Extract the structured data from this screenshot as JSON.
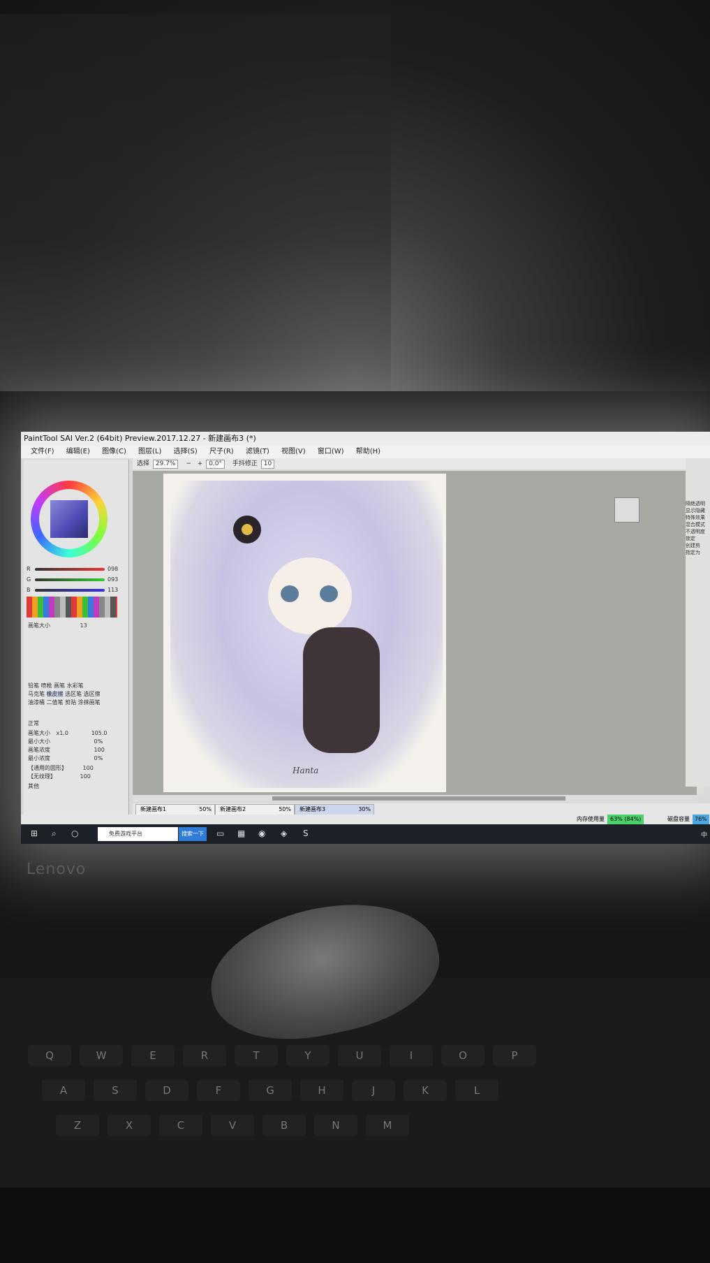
{
  "window": {
    "title": "PaintTool SAI Ver.2 (64bit) Preview.2017.12.27 - 新建画布3 (*)"
  },
  "menu": [
    "文件(F)",
    "编辑(E)",
    "图像(C)",
    "图层(L)",
    "选择(S)",
    "尺子(R)",
    "滤镜(T)",
    "视图(V)",
    "窗口(W)",
    "帮助(H)"
  ],
  "toolbar": {
    "select_label": "选择",
    "zoom": "29.7%",
    "rotation": "0.0°",
    "stabilizer_label": "手抖修正",
    "stabilizer_value": "10"
  },
  "color": {
    "r_label": "R",
    "r": "098",
    "g_label": "G",
    "g": "093",
    "b_label": "B",
    "b": "113"
  },
  "brush": {
    "size_label": "画笔大小",
    "size_value": "13",
    "tools": [
      "铅笔",
      "喷枪",
      "画笔",
      "水彩笔",
      "马克笔",
      "橡皮擦",
      "选区笔",
      "选区擦",
      "油漆桶",
      "二值笔",
      "剪贴",
      "涂抹画笔"
    ],
    "mode": "正常",
    "brush_size_label": "画笔大小",
    "brush_size_mult": "x1.0",
    "brush_size_value": "105.0",
    "min_size_label": "最小大小",
    "min_size_value": "0%",
    "density_label": "画笔浓度",
    "density_value": "100",
    "min_density_label": "最小浓度",
    "min_density_value": "0%",
    "shape_label": "【通用的圆形】",
    "shape_value": "100",
    "texture_label": "【无纹理】",
    "texture_value": "100",
    "other_label": "其他"
  },
  "canvas": {
    "signature": "Hanta"
  },
  "tabs": [
    {
      "name": "新建画布1",
      "pct": "50%"
    },
    {
      "name": "新建画布2",
      "pct": "50%"
    },
    {
      "name": "新建画布3",
      "pct": "30%"
    }
  ],
  "status": {
    "memory_label": "内存使用量",
    "memory_value": "63% (84%)",
    "disk_label": "磁盘容量",
    "disk_value": "76%"
  },
  "right_panel": [
    "隔绝透明",
    "显示隐藏",
    "特殊效果",
    "混合模式",
    "不透明度",
    "锁定",
    "创建剪",
    "指定为"
  ],
  "taskbar": {
    "search_text": "免费游戏平台",
    "search_button": "搜索一下",
    "tray_ime": "中"
  },
  "brand": "Lenovo",
  "keyboard": {
    "row1": [
      "Q",
      "W",
      "E",
      "R",
      "T",
      "Y",
      "U",
      "I",
      "O",
      "P"
    ],
    "row2": [
      "A",
      "S",
      "D",
      "F",
      "G",
      "H",
      "J",
      "K",
      "L"
    ],
    "row3": [
      "Z",
      "X",
      "C",
      "V",
      "B",
      "N",
      "M"
    ]
  }
}
